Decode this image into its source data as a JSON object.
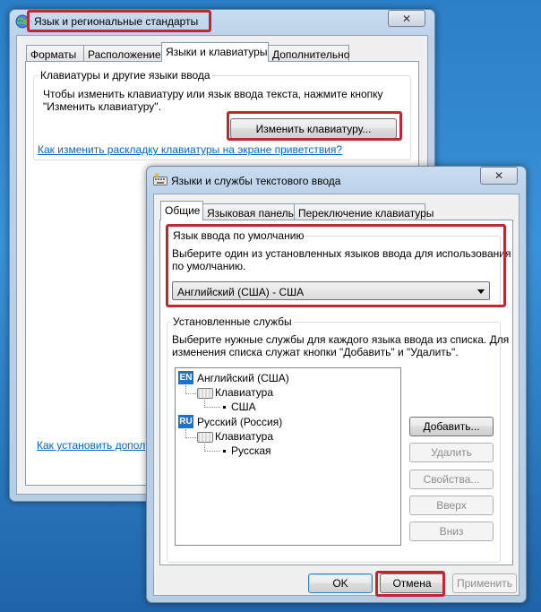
{
  "window_back": {
    "title": "Язык и региональные стандарты",
    "close_glyph": "✕",
    "tabs": [
      {
        "label": "Форматы"
      },
      {
        "label": "Расположение"
      },
      {
        "label": "Языки и клавиатуры"
      },
      {
        "label": "Дополнительно"
      }
    ],
    "group_title": "Клавиатуры и другие языки ввода",
    "group_text_1": "Чтобы изменить клавиатуру или язык ввода текста, нажмите кнопку",
    "group_text_2": "\"Изменить клавиатуру\".",
    "change_keyboard_button": "Изменить клавиатуру...",
    "welcome_screen_link": "Как изменить раскладку клавиатуры на экране приветствия?",
    "install_link": "Как установить допол"
  },
  "window_front": {
    "title": "Языки и службы текстового ввода",
    "close_glyph": "✕",
    "tabs": [
      {
        "label": "Общие"
      },
      {
        "label": "Языковая панель"
      },
      {
        "label": "Переключение клавиатуры"
      }
    ],
    "default_lang": {
      "title": "Язык ввода по умолчанию",
      "text_1": "Выберите один из установленных языков ввода для использования",
      "text_2": "по умолчанию.",
      "selected": "Английский (США) - США"
    },
    "installed": {
      "title": "Установленные службы",
      "text_1": "Выберите нужные службы для каждого языка ввода из списка. Для",
      "text_2": "изменения списка служат кнопки \"Добавить\" и \"Удалить\".",
      "tree": {
        "en_badge": "EN",
        "en_lang": "Английский (США)",
        "en_group": "Клавиатура",
        "en_layout": "США",
        "ru_badge": "RU",
        "ru_lang": "Русский (Россия)",
        "ru_group": "Клавиатура",
        "ru_layout": "Русская"
      },
      "buttons": {
        "add": "Добавить...",
        "remove": "Удалить",
        "properties": "Свойства...",
        "up": "Вверх",
        "down": "Вниз"
      }
    },
    "ok": "OK",
    "cancel": "Отмена",
    "apply": "Применить"
  },
  "colors": {
    "highlight": "#c0282f",
    "link": "#0066cc",
    "badge": "#1e73c8"
  }
}
